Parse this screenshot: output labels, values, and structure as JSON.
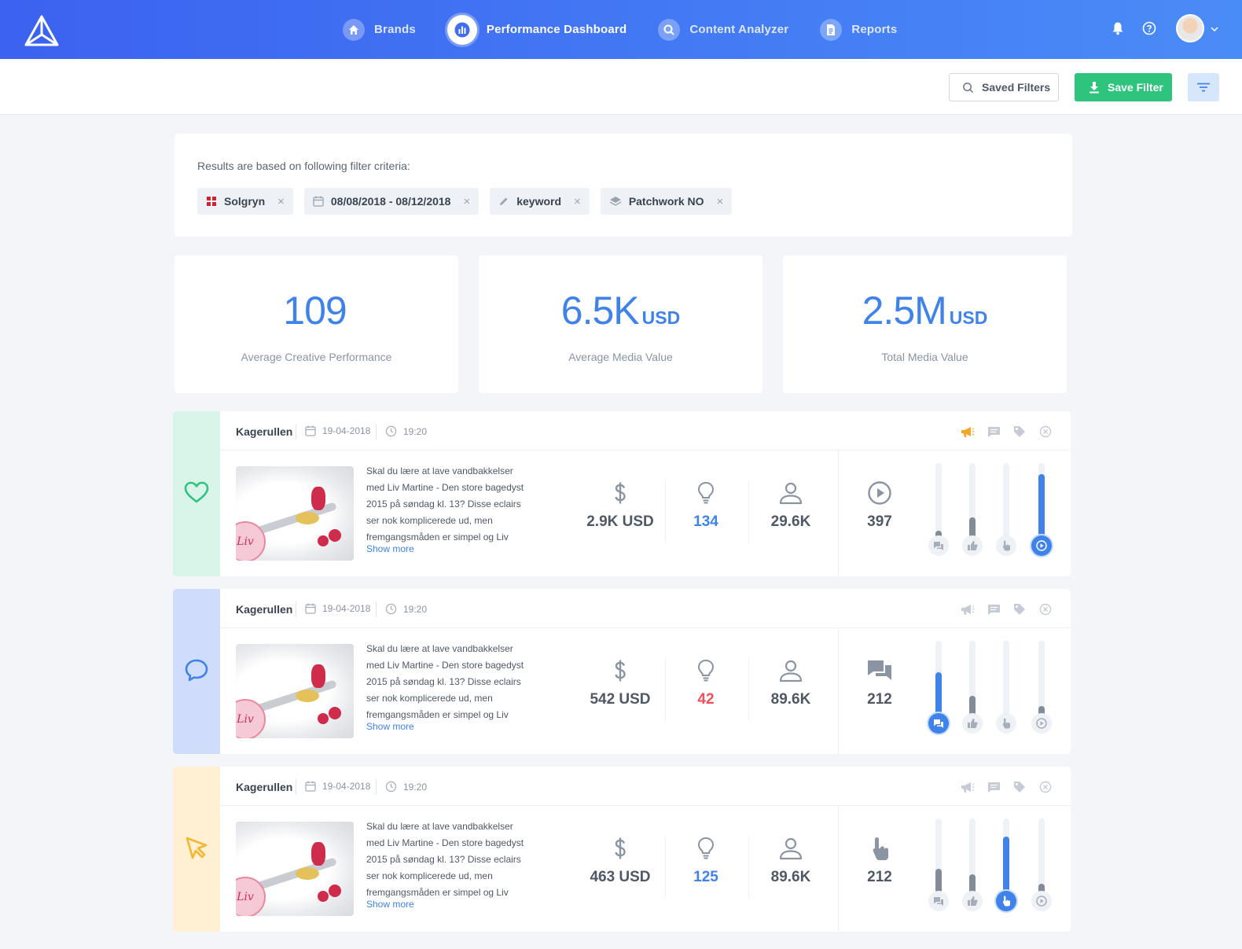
{
  "nav": {
    "items": [
      {
        "label": "Brands",
        "icon": "home-icon",
        "active": false
      },
      {
        "label": "Performance Dashboard",
        "icon": "bar-chart-icon",
        "active": true
      },
      {
        "label": "Content Analyzer",
        "icon": "search-icon",
        "active": false
      },
      {
        "label": "Reports",
        "icon": "document-icon",
        "active": false
      }
    ]
  },
  "toolbar": {
    "saved_filters_label": "Saved Filters",
    "save_filter_label": "Save Filter"
  },
  "criteria": {
    "title": "Results are based on following filter criteria:",
    "chips": [
      {
        "label": "Solgryn",
        "icon": "brand-logo-icon"
      },
      {
        "label": "08/08/2018 - 08/12/2018",
        "icon": "calendar-icon"
      },
      {
        "label": "keyword",
        "icon": "pencil-icon"
      },
      {
        "label": "Patchwork NO",
        "icon": "layers-icon"
      }
    ],
    "chip_remove": "×"
  },
  "stats": [
    {
      "value": "109",
      "unit": "",
      "label": "Average Creative Performance"
    },
    {
      "value": "6.5K",
      "unit": "USD",
      "label": "Average Media Value"
    },
    {
      "value": "2.5M",
      "unit": "USD",
      "label": "Total Media Value"
    }
  ],
  "colors": {
    "accent": "#3f83ea",
    "green": "#2ec47e",
    "red": "#f0505a",
    "orange": "#f5a623"
  },
  "posts": [
    {
      "type": "heart-icon",
      "side_color": "#d9f5ea",
      "author": "Kagerullen",
      "date": "19-04-2018",
      "time": "19:20",
      "description": "Skal du lære at lave vandbakkelser med Liv Martine - Den store bagedyst 2015 på søndag kl. 13? Disse eclairs ser nok komplicerede ud, men fremgangsmåden er simpel og Liv",
      "show_more": "Show more",
      "thumb_stamp": "Liv",
      "media_value": "2.9K USD",
      "creative": "134",
      "creative_color": "#3f83ea",
      "reach": "29.6K",
      "primary_icon": "play-icon",
      "primary_value": "397",
      "megaphone_active": true,
      "bars": [
        {
          "name": "comments",
          "level": 0.1,
          "active": false
        },
        {
          "name": "likes",
          "level": 0.28,
          "active": false
        },
        {
          "name": "clicks",
          "level": 0.04,
          "active": false
        },
        {
          "name": "views",
          "level": 0.85,
          "active": true
        }
      ]
    },
    {
      "type": "comment-icon",
      "side_color": "#cfdcfb",
      "author": "Kagerullen",
      "date": "19-04-2018",
      "time": "19:20",
      "description": "Skal du lære at lave vandbakkelser med Liv Martine - Den store bagedyst 2015 på søndag kl. 13? Disse eclairs ser nok komplicerede ud, men fremgangsmåden er simpel og Liv",
      "show_more": "Show more",
      "thumb_stamp": "Liv",
      "media_value": "542 USD",
      "creative": "42",
      "creative_color": "#f0505a",
      "reach": "89.6K",
      "primary_icon": "chat-icon",
      "primary_value": "212",
      "megaphone_active": false,
      "bars": [
        {
          "name": "comments",
          "level": 0.58,
          "active": true
        },
        {
          "name": "likes",
          "level": 0.27,
          "active": false
        },
        {
          "name": "clicks",
          "level": 0.04,
          "active": false
        },
        {
          "name": "views",
          "level": 0.14,
          "active": false
        }
      ]
    },
    {
      "type": "cursor-icon",
      "side_color": "#fff0d4",
      "author": "Kagerullen",
      "date": "19-04-2018",
      "time": "19:20",
      "description": "Skal du lære at lave vandbakkelser med Liv Martine - Den store bagedyst 2015 på søndag kl. 13? Disse eclairs ser nok komplicerede ud, men fremgangsmåden er simpel og Liv",
      "show_more": "Show more",
      "thumb_stamp": "Liv",
      "media_value": "463 USD",
      "creative": "125",
      "creative_color": "#3f83ea",
      "reach": "89.6K",
      "primary_icon": "tap-icon",
      "primary_value": "212",
      "megaphone_active": false,
      "bars": [
        {
          "name": "comments",
          "level": 0.33,
          "active": false
        },
        {
          "name": "likes",
          "level": 0.26,
          "active": false
        },
        {
          "name": "clicks",
          "level": 0.76,
          "active": true
        },
        {
          "name": "views",
          "level": 0.14,
          "active": false
        }
      ]
    }
  ]
}
